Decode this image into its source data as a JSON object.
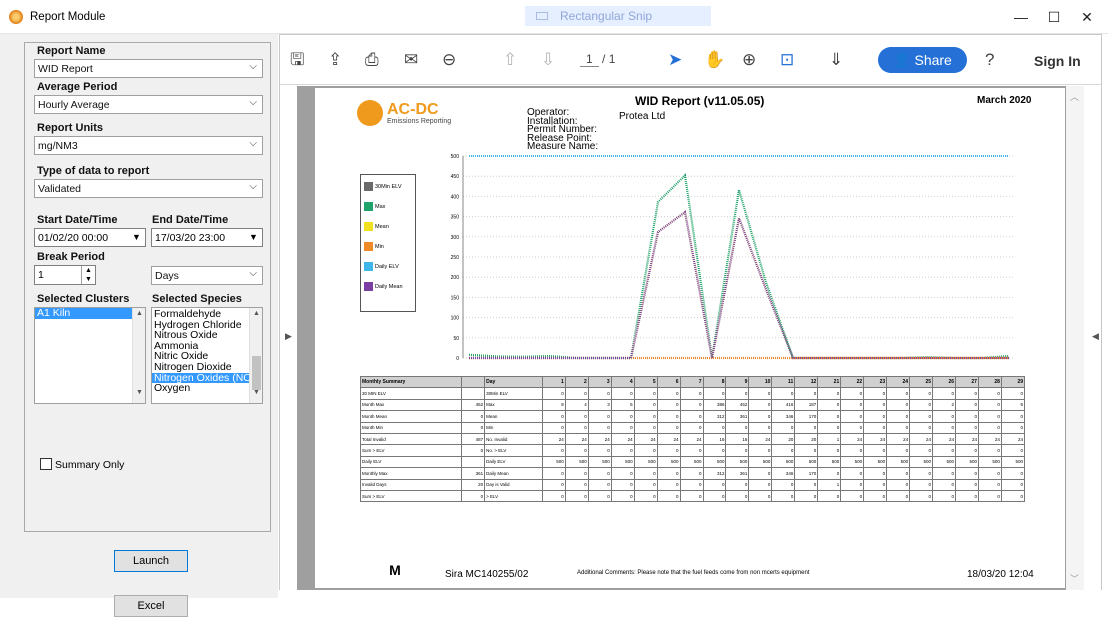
{
  "window": {
    "title": "Report Module",
    "snip_label": "Rectangular Snip",
    "minimize": "—",
    "maximize": "☐",
    "close": "✕"
  },
  "left": {
    "report_name_label": "Report Name",
    "report_name_value": "WID Report",
    "average_period_label": "Average Period",
    "average_period_value": "Hourly Average",
    "report_units_label": "Report Units",
    "report_units_value": "mg/NM3",
    "data_type_label": "Type of data to report",
    "data_type_value": "Validated",
    "start_label": "Start Date/Time",
    "start_value": "01/02/20 00:00",
    "end_label": "End Date/Time",
    "end_value": "17/03/20 23:00",
    "break_label": "Break Period",
    "break_value": "1",
    "break_unit": "Days",
    "clusters_label": "Selected Clusters",
    "clusters": [
      "A1 Kiln"
    ],
    "species_label": "Selected Species",
    "species": [
      "Formaldehyde",
      "Hydrogen Chloride",
      "Nitrous Oxide",
      "Ammonia",
      "Nitric Oxide",
      "Nitrogen Dioxide",
      "Nitrogen Oxides (NOx",
      "Oxygen"
    ],
    "species_selected": "Nitrogen Oxides (NOx",
    "summary_only": "Summary Only",
    "launch": "Launch",
    "excel": "Excel"
  },
  "toolbar": {
    "page_current": "1",
    "page_total": "/ 1",
    "share": "Share",
    "signin": "Sign In"
  },
  "report": {
    "logo_name": "AC-DC",
    "logo_sub": "Emissions Reporting",
    "title": "WID Report (v11.05.05)",
    "date": "March 2020",
    "meta_labels": [
      "Operator:",
      "Installation:",
      "Permit Number:",
      "Release Point:",
      "Measure Name:"
    ],
    "operator_value": "Protea Ltd",
    "legend": [
      {
        "name": "30Min ELV",
        "color": "#6b6b6b"
      },
      {
        "name": "Max",
        "color": "#1fa36a"
      },
      {
        "name": "Mean",
        "color": "#f0e020"
      },
      {
        "name": "Min",
        "color": "#f08c28"
      },
      {
        "name": "Daily ELV",
        "color": "#3fb6e8"
      },
      {
        "name": "Daily Mean",
        "color": "#7a3fa0"
      }
    ],
    "footer_id": "Sira MC140255/02",
    "footer_comments": "Additional Comments: Please note that the fuel feeds come from non mcerts equipment",
    "footer_timestamp": "18/03/20 12:04"
  },
  "chart_data": {
    "type": "line",
    "x": [
      "1",
      "2",
      "3",
      "4",
      "5",
      "6",
      "7",
      "8",
      "9",
      "10",
      "11",
      "12",
      "21",
      "22",
      "23",
      "24",
      "25",
      "26",
      "27",
      "28",
      "29"
    ],
    "ylim": [
      0,
      500
    ],
    "yticks": [
      "500",
      "450",
      "400",
      "350",
      "300",
      "250",
      "200",
      "150",
      "100",
      "50",
      "0"
    ],
    "series": [
      {
        "name": "Max",
        "color": "#1fa36a",
        "values": [
          8,
          4,
          3,
          5,
          0,
          0,
          0,
          386,
          452,
          0,
          416,
          187,
          0,
          0,
          0,
          0,
          0,
          2,
          0,
          0,
          5
        ]
      },
      {
        "name": "Mean",
        "color": "#f0e020",
        "values": [
          0,
          0,
          0,
          0,
          0,
          0,
          0,
          312,
          361,
          0,
          346,
          170,
          0,
          0,
          0,
          0,
          0,
          0,
          0,
          0,
          0
        ]
      },
      {
        "name": "Min",
        "color": "#f08c28",
        "values": [
          0,
          0,
          0,
          0,
          0,
          0,
          0,
          0,
          0,
          0,
          0,
          0,
          0,
          0,
          0,
          0,
          0,
          0,
          0,
          0,
          0
        ]
      },
      {
        "name": "Daily ELV",
        "color": "#3fb6e8",
        "values": [
          500,
          500,
          500,
          500,
          500,
          500,
          500,
          500,
          500,
          500,
          500,
          500,
          500,
          500,
          500,
          500,
          500,
          500,
          500,
          500,
          500
        ]
      },
      {
        "name": "Daily Mean",
        "color": "#7a3fa0",
        "values": [
          0,
          0,
          0,
          0,
          0,
          0,
          0,
          312,
          361,
          0,
          346,
          170,
          0,
          0,
          0,
          0,
          0,
          0,
          0,
          0,
          0
        ]
      }
    ]
  },
  "summary": {
    "header": [
      "Monthly Summary",
      "",
      "Day"
    ],
    "rows": [
      {
        "label": "30 MIN ELV",
        "val": "",
        "name": "30Min ELV",
        "cells": [
          "0",
          "0",
          "0",
          "0",
          "0",
          "0",
          "0",
          "0",
          "0",
          "0",
          "0",
          "0",
          "0",
          "0",
          "0",
          "0",
          "0",
          "0",
          "0",
          "0",
          "0"
        ]
      },
      {
        "label": "Month Max",
        "val": "452",
        "name": "Max",
        "cells": [
          "8",
          "4",
          "3",
          "5",
          "0",
          "0",
          "0",
          "386",
          "452",
          "0",
          "416",
          "187",
          "0",
          "0",
          "0",
          "0",
          "0",
          "2",
          "0",
          "0",
          "5"
        ]
      },
      {
        "label": "Month Mean",
        "val": "0",
        "name": "Mean",
        "cells": [
          "0",
          "0",
          "0",
          "0",
          "0",
          "0",
          "0",
          "312",
          "361",
          "0",
          "346",
          "170",
          "0",
          "0",
          "0",
          "0",
          "0",
          "0",
          "0",
          "0",
          "0"
        ]
      },
      {
        "label": "Month Min",
        "val": "0",
        "name": "Min",
        "cells": [
          "0",
          "0",
          "0",
          "0",
          "0",
          "0",
          "0",
          "0",
          "0",
          "0",
          "0",
          "0",
          "0",
          "0",
          "0",
          "0",
          "0",
          "0",
          "0",
          "0",
          "0"
        ]
      },
      {
        "label": "Total Invalid",
        "val": "487",
        "name": "No. Invalid",
        "cells": [
          "24",
          "24",
          "24",
          "24",
          "24",
          "24",
          "24",
          "16",
          "16",
          "24",
          "20",
          "20",
          "1",
          "24",
          "24",
          "24",
          "24",
          "24",
          "24",
          "24",
          "24"
        ]
      },
      {
        "label": "Sum > ELV",
        "val": "0",
        "name": "No. > ELV",
        "cells": [
          "0",
          "0",
          "0",
          "0",
          "0",
          "0",
          "0",
          "0",
          "0",
          "0",
          "0",
          "0",
          "0",
          "0",
          "0",
          "0",
          "0",
          "0",
          "0",
          "0",
          "0"
        ]
      },
      {
        "label": "Daily ELV",
        "val": "",
        "name": "Daily ELV",
        "cells": [
          "500",
          "500",
          "500",
          "500",
          "500",
          "500",
          "500",
          "500",
          "500",
          "500",
          "500",
          "500",
          "500",
          "500",
          "500",
          "500",
          "500",
          "500",
          "500",
          "500",
          "500"
        ]
      },
      {
        "label": "Monthly Max",
        "val": "361",
        "name": "Daily Mean",
        "cells": [
          "0",
          "0",
          "0",
          "0",
          "0",
          "0",
          "0",
          "312",
          "361",
          "0",
          "346",
          "170",
          "0",
          "0",
          "0",
          "0",
          "0",
          "0",
          "0",
          "0",
          "0"
        ]
      },
      {
        "label": "Invalid Days",
        "val": "20",
        "name": "Day is Valid",
        "cells": [
          "0",
          "0",
          "0",
          "0",
          "0",
          "0",
          "0",
          "0",
          "0",
          "0",
          "0",
          "0",
          "1",
          "0",
          "0",
          "0",
          "0",
          "0",
          "0",
          "0",
          "0"
        ]
      },
      {
        "label": "Sum > ELV",
        "val": "0",
        "name": "> ELV",
        "cells": [
          "0",
          "0",
          "0",
          "0",
          "0",
          "0",
          "0",
          "0",
          "0",
          "0",
          "0",
          "0",
          "0",
          "0",
          "0",
          "0",
          "0",
          "0",
          "0",
          "0",
          "0"
        ]
      }
    ]
  }
}
